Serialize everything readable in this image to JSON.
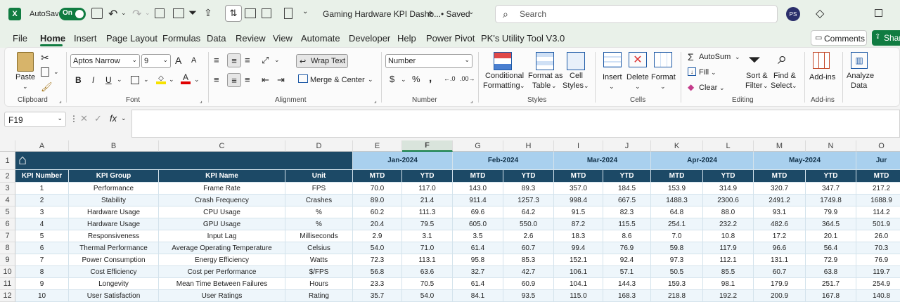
{
  "titlebar": {
    "autosave_label": "AutoSave",
    "autosave_state": "On",
    "doc_title": "Gaming Hardware KPI Dashb...",
    "saved_label": "• Saved",
    "search_placeholder": "Search",
    "user_initials": "PS"
  },
  "menu": [
    "File",
    "Home",
    "Insert",
    "Page Layout",
    "Formulas",
    "Data",
    "Review",
    "View",
    "Automate",
    "Developer",
    "Help",
    "Power Pivot",
    "PK's Utility Tool V3.0"
  ],
  "menu_active": "Home",
  "comments_label": "Comments",
  "share_label": "Shar",
  "ribbon": {
    "clipboard": {
      "paste": "Paste",
      "group": "Clipboard"
    },
    "font": {
      "name": "Aptos Narrow",
      "size": "9",
      "group": "Font"
    },
    "alignment": {
      "wrap": "Wrap Text",
      "merge": "Merge & Center",
      "group": "Alignment"
    },
    "number": {
      "format": "Number",
      "group": "Number"
    },
    "styles": {
      "cond1": "Conditional",
      "cond2": "Formatting",
      "fmt1": "Format as",
      "fmt2": "Table",
      "cell1": "Cell",
      "cell2": "Styles",
      "group": "Styles"
    },
    "cells": {
      "insert": "Insert",
      "delete": "Delete",
      "format": "Format",
      "group": "Cells"
    },
    "editing": {
      "autosum": "AutoSum",
      "fill": "Fill",
      "clear": "Clear",
      "sort1": "Sort &",
      "sort2": "Filter",
      "find1": "Find &",
      "find2": "Select",
      "group": "Editing"
    },
    "addins": {
      "addins": "Add-ins",
      "analyze1": "Analyze",
      "analyze2": "Data",
      "group": "Add-ins"
    }
  },
  "formula_bar": {
    "name_box": "F19",
    "fx": "fx",
    "value": ""
  },
  "columns": [
    "A",
    "B",
    "C",
    "D",
    "E",
    "F",
    "G",
    "H",
    "I",
    "J",
    "K",
    "L",
    "M",
    "N",
    "O"
  ],
  "rows": [
    "1",
    "2",
    "3",
    "4",
    "5",
    "6",
    "7",
    "8",
    "9",
    "10",
    "11",
    "12"
  ],
  "months": [
    "Jan-2024",
    "Feb-2024",
    "Mar-2024",
    "Apr-2024",
    "May-2024",
    "Jur"
  ],
  "headers": {
    "kpi_number": "KPI Number",
    "kpi_group": "KPI Group",
    "kpi_name": "KPI Name",
    "unit": "Unit",
    "mtd": "MTD",
    "ytd": "YTD"
  },
  "table": [
    {
      "num": "1",
      "group": "Performance",
      "name": "Frame Rate",
      "unit": "FPS",
      "vals": [
        "70.0",
        "117.0",
        "143.0",
        "89.3",
        "357.0",
        "184.5",
        "153.9",
        "314.9",
        "320.7",
        "347.7",
        "217.2"
      ]
    },
    {
      "num": "2",
      "group": "Stability",
      "name": "Crash Frequency",
      "unit": "Crashes",
      "vals": [
        "89.0",
        "21.4",
        "911.4",
        "1257.3",
        "998.4",
        "667.5",
        "1488.3",
        "2300.6",
        "2491.2",
        "1749.8",
        "1688.9"
      ]
    },
    {
      "num": "3",
      "group": "Hardware Usage",
      "name": "CPU Usage",
      "unit": "%",
      "vals": [
        "60.2",
        "111.3",
        "69.6",
        "64.2",
        "91.5",
        "82.3",
        "64.8",
        "88.0",
        "93.1",
        "79.9",
        "114.2"
      ]
    },
    {
      "num": "4",
      "group": "Hardware Usage",
      "name": "GPU Usage",
      "unit": "%",
      "vals": [
        "20.4",
        "79.5",
        "605.0",
        "550.0",
        "87.2",
        "115.5",
        "254.1",
        "232.2",
        "482.6",
        "364.5",
        "501.9"
      ]
    },
    {
      "num": "5",
      "group": "Responsiveness",
      "name": "Input Lag",
      "unit": "Milliseconds",
      "vals": [
        "2.9",
        "3.1",
        "3.5",
        "2.6",
        "18.3",
        "8.6",
        "7.0",
        "10.8",
        "17.2",
        "20.1",
        "26.0"
      ]
    },
    {
      "num": "6",
      "group": "Thermal Performance",
      "name": "Average Operating Temperature",
      "unit": "Celsius",
      "vals": [
        "54.0",
        "71.0",
        "61.4",
        "60.7",
        "99.4",
        "76.9",
        "59.8",
        "117.9",
        "96.6",
        "56.4",
        "70.3"
      ]
    },
    {
      "num": "7",
      "group": "Power Consumption",
      "name": "Energy Efficiency",
      "unit": "Watts",
      "vals": [
        "72.3",
        "113.1",
        "95.8",
        "85.3",
        "152.1",
        "92.4",
        "97.3",
        "112.1",
        "131.1",
        "72.9",
        "76.9"
      ]
    },
    {
      "num": "8",
      "group": "Cost Efficiency",
      "name": "Cost per Performance",
      "unit": "$/FPS",
      "vals": [
        "56.8",
        "63.6",
        "32.7",
        "42.7",
        "106.1",
        "57.1",
        "50.5",
        "85.5",
        "60.7",
        "63.8",
        "119.7"
      ]
    },
    {
      "num": "9",
      "group": "Longevity",
      "name": "Mean Time Between Failures",
      "unit": "Hours",
      "vals": [
        "23.3",
        "70.5",
        "61.4",
        "60.9",
        "104.1",
        "144.3",
        "159.3",
        "98.1",
        "179.9",
        "251.7",
        "254.9"
      ]
    },
    {
      "num": "10",
      "group": "User Satisfaction",
      "name": "User Ratings",
      "unit": "Rating",
      "vals": [
        "35.7",
        "54.0",
        "84.1",
        "93.5",
        "115.0",
        "168.3",
        "218.8",
        "192.2",
        "200.9",
        "167.8",
        "140.8"
      ]
    }
  ],
  "colors": {
    "header_dark": "#1c4966",
    "header_light": "#a9d0ee",
    "excel_green": "#107c41"
  }
}
